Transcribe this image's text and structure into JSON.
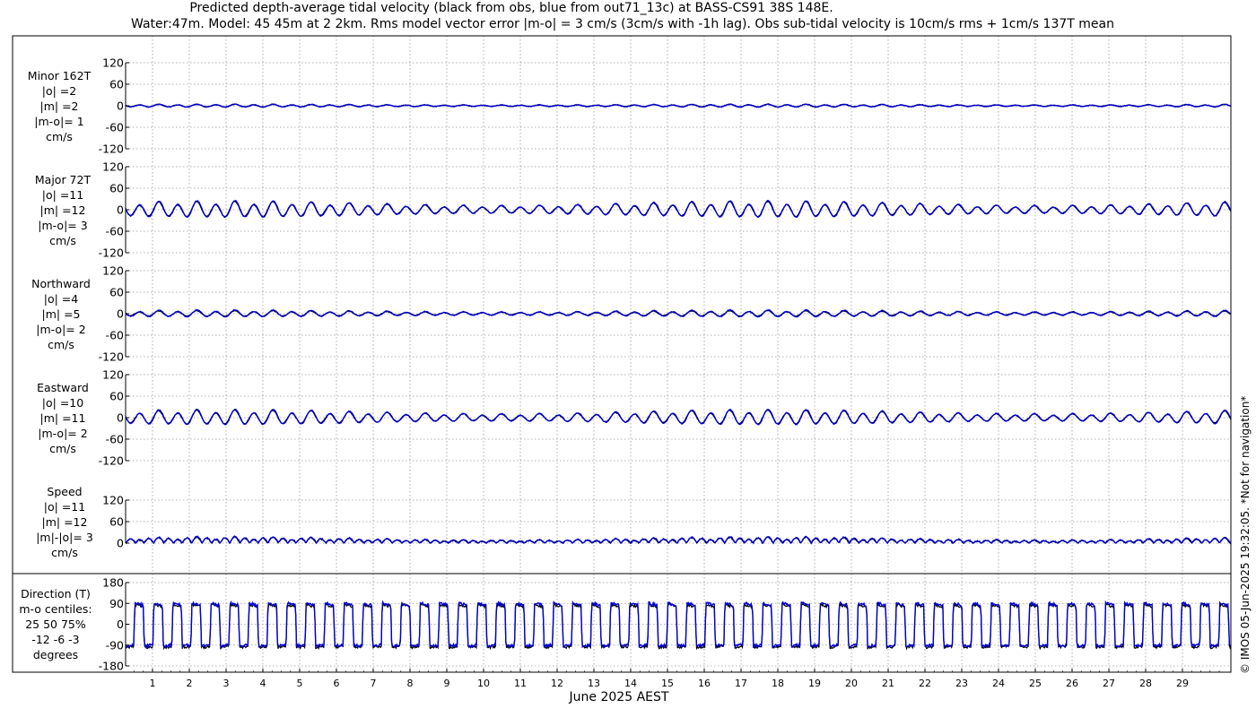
{
  "header": {
    "title_line1": "Predicted depth-average tidal velocity (black from obs, blue from out71_13c) at BASS-CS91 38S 148E.",
    "title_line2": "Water:47m. Model: 45 45m at 2 2km. Rms model vector error |m-o| = 3 cm/s (3cm/s with -1h lag). Obs sub-tidal velocity is 10cm/s rms + 1cm/s 137T mean"
  },
  "side_note": "© IMOS 05-Jun-2025 19:32:05. *Not for navigation*",
  "colors": {
    "obs": "#000000",
    "model": "#0000cc",
    "grid": "#9a9a9a"
  },
  "chart_data": {
    "type": "line",
    "xlabel": "June 2025 AEST",
    "xticks": [
      "1",
      "2",
      "3",
      "4",
      "5",
      "6",
      "7",
      "8",
      "9",
      "10",
      "11",
      "12",
      "13",
      "14",
      "15",
      "16",
      "17",
      "18",
      "19",
      "20",
      "21",
      "22",
      "23",
      "24",
      "25",
      "26",
      "27",
      "28",
      "29"
    ],
    "xlim_days": [
      0.0,
      30.0
    ],
    "tidal_period_hours": 12.42,
    "series": [
      {
        "name": "obs"
      },
      {
        "name": "model"
      }
    ],
    "panels": [
      {
        "label": [
          "Minor 162T",
          "|o| =2",
          "|m| =2",
          "|m-o|= 1",
          "cm/s"
        ],
        "yticks": [
          "120",
          "60",
          "0",
          "-60",
          "-120"
        ],
        "ylim": [
          -120,
          120
        ],
        "obs_rms": 2,
        "model_rms": 2
      },
      {
        "label": [
          "Major 72T",
          "|o| =11",
          "|m| =12",
          "|m-o|= 3",
          "cm/s"
        ],
        "yticks": [
          "120",
          "60",
          "0",
          "-60",
          "-120"
        ],
        "ylim": [
          -120,
          120
        ],
        "obs_rms": 11,
        "model_rms": 12
      },
      {
        "label": [
          "Northward",
          "|o| =4",
          "|m| =5",
          "|m-o|= 2",
          "cm/s"
        ],
        "yticks": [
          "120",
          "60",
          "0",
          "-60",
          "-120"
        ],
        "ylim": [
          -120,
          120
        ],
        "obs_rms": 4,
        "model_rms": 5
      },
      {
        "label": [
          "Eastward",
          "|o| =10",
          "|m| =11",
          "|m-o|= 2",
          "cm/s"
        ],
        "yticks": [
          "120",
          "60",
          "0",
          "-60",
          "-120"
        ],
        "ylim": [
          -120,
          120
        ],
        "obs_rms": 10,
        "model_rms": 11
      },
      {
        "label": [
          "Speed",
          "|o| =11",
          "|m| =12",
          "|m|-|o|= 3",
          "cm/s"
        ],
        "yticks": [
          "120",
          "60",
          "0"
        ],
        "ylim": [
          0,
          120
        ],
        "obs_rms": 11,
        "model_rms": 12
      },
      {
        "label": [
          "Direction (T)",
          "m-o centiles:",
          "25  50  75%",
          "-12  -6  -3",
          "degrees"
        ],
        "yticks": [
          "180",
          "90",
          "0",
          "-90",
          "-180"
        ],
        "ylim": [
          -180,
          180
        ],
        "type": "direction"
      }
    ]
  }
}
